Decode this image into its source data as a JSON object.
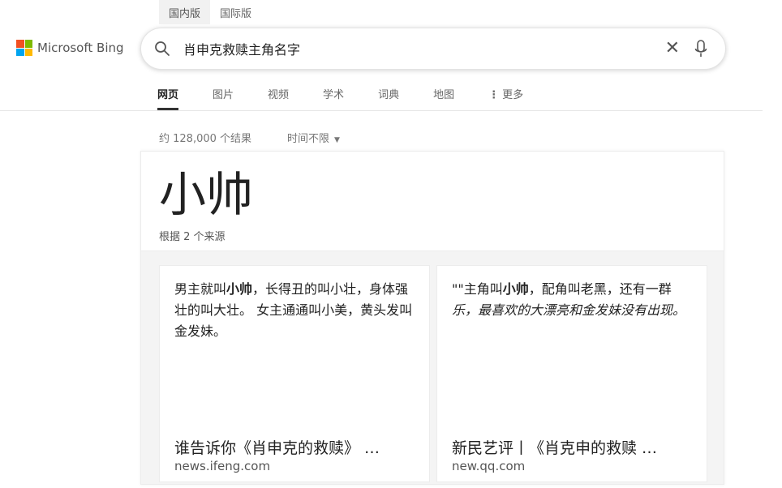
{
  "region_tabs": [
    {
      "label": "国内版",
      "active": true
    },
    {
      "label": "国际版",
      "active": false
    }
  ],
  "logo": {
    "text": "Microsoft Bing",
    "colors": [
      "#f25022",
      "#7fba00",
      "#00a4ef",
      "#ffb900"
    ]
  },
  "search": {
    "value": "肖申克救赎主角名字",
    "icons": [
      "search-icon",
      "clear-icon",
      "microphone-icon"
    ],
    "clear_glyph": "✕"
  },
  "nav": {
    "items": [
      "网页",
      "图片",
      "视频",
      "学术",
      "词典",
      "地图"
    ],
    "active_index": 0,
    "more_label": "更多"
  },
  "results": {
    "count": "约 128,000 个结果",
    "time_filter": "时间不限"
  },
  "answer": {
    "title": "小帅",
    "sources_label": "根据 2 个来源",
    "sources": [
      {
        "snippet_parts": [
          {
            "text": "男主就叫",
            "style": "normal"
          },
          {
            "text": "小帅",
            "style": "bold"
          },
          {
            "text": "，长得丑的叫小壮，身体强壮的叫大壮。 女主通通叫小美，黄头发叫金发妹。",
            "style": "normal"
          }
        ],
        "title": "谁告诉你《肖申克的救赎》 …",
        "domain": "news.ifeng.com"
      },
      {
        "snippet_parts": [
          {
            "text": "\"\"主角叫",
            "style": "normal"
          },
          {
            "text": "小帅",
            "style": "bold"
          },
          {
            "text": "，配角叫老黑，还有一群",
            "style": "normal"
          },
          {
            "text": "乐，最喜欢的大漂亮和金发妹没有出现。",
            "style": "italic"
          }
        ],
        "title": "新民艺评丨《肖克申的救赎 …",
        "domain": "new.qq.com"
      }
    ]
  }
}
